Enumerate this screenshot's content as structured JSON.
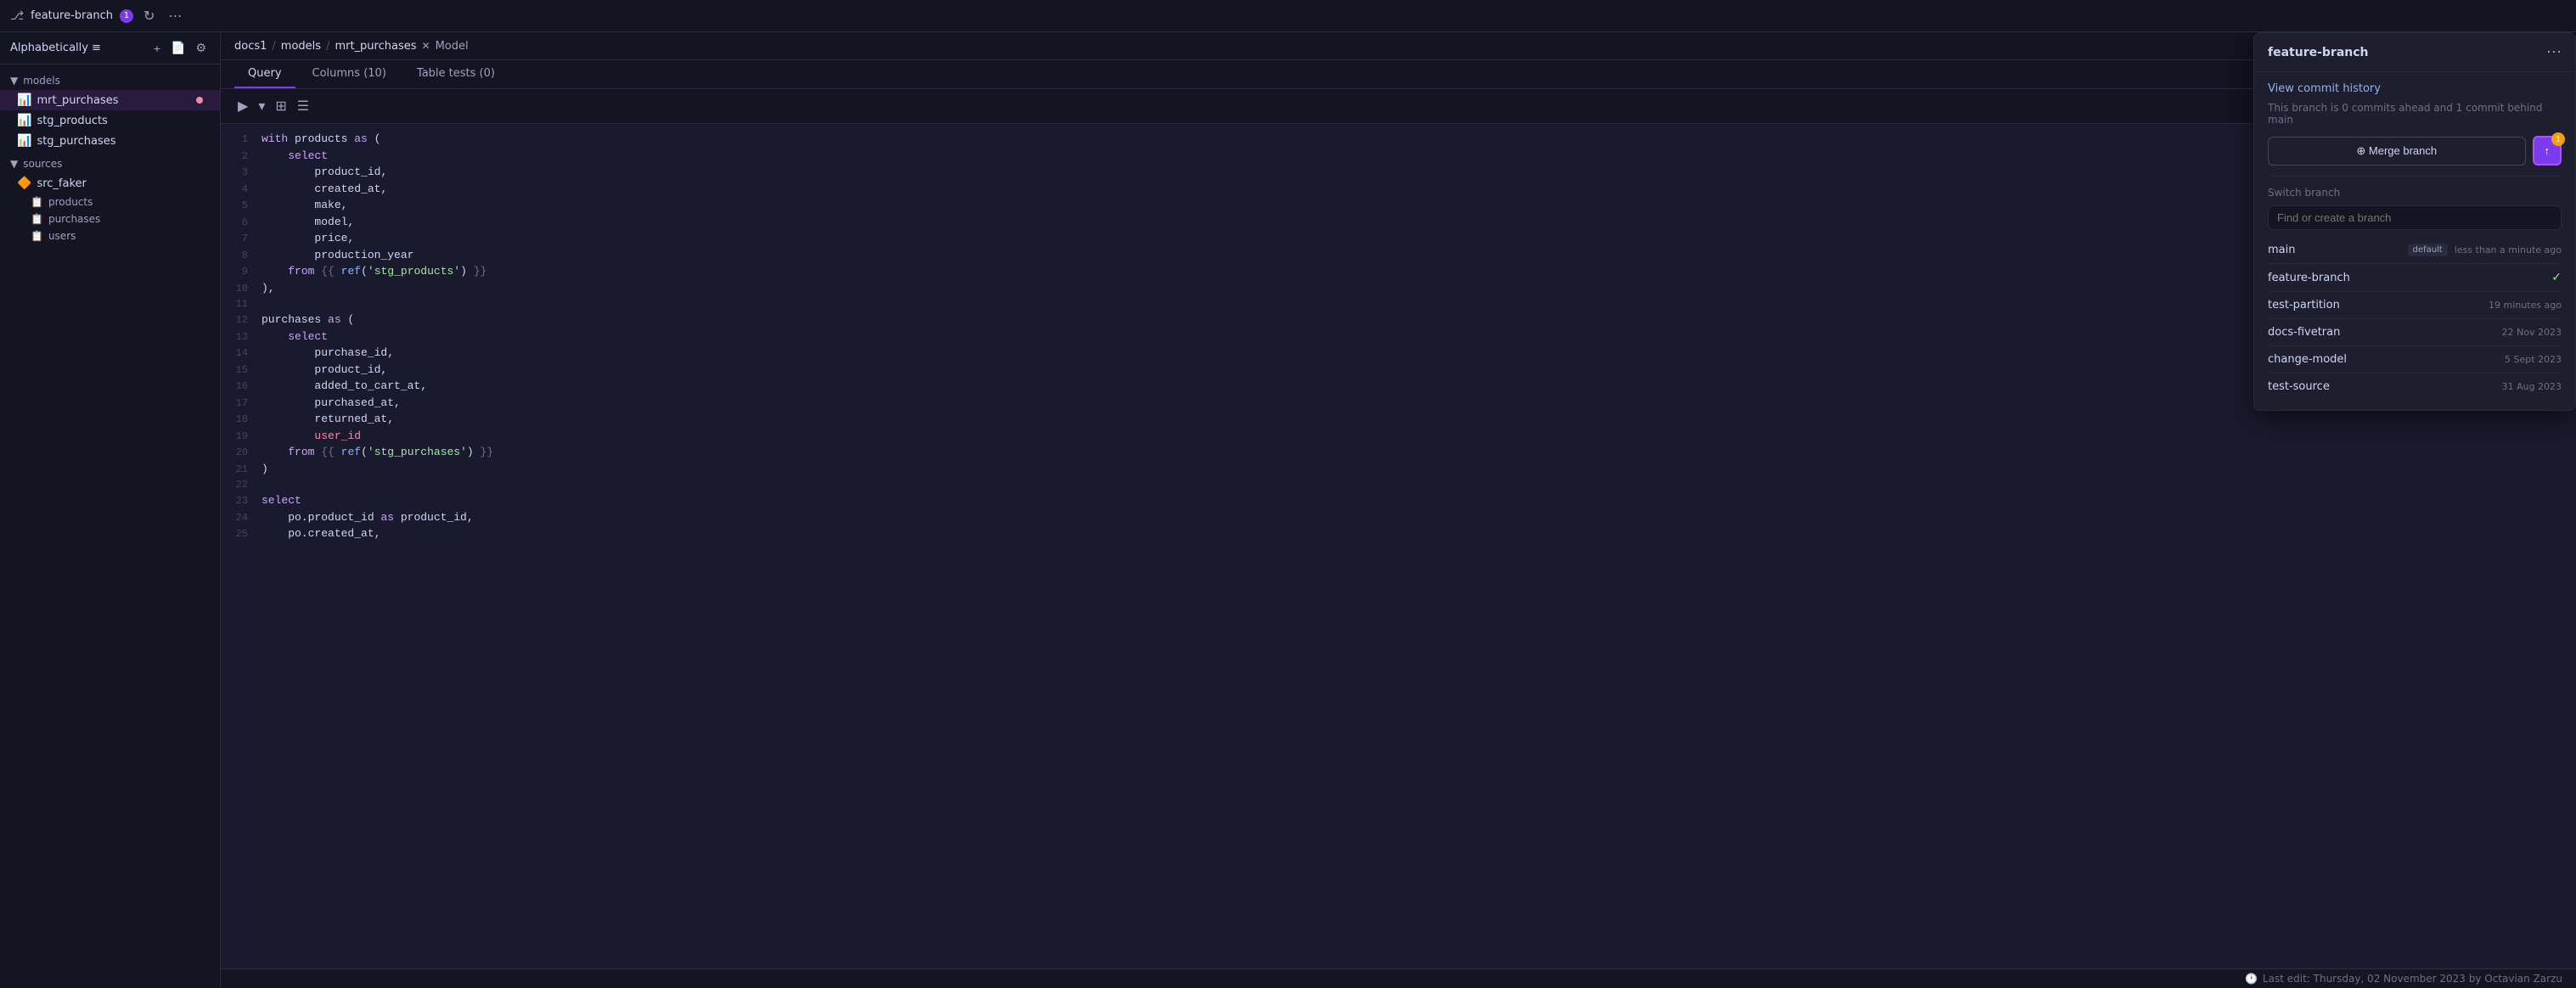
{
  "topbar": {
    "branch_name": "feature-branch",
    "branch_badge": "1",
    "refresh_icon": "↻",
    "more_icon": "⋯"
  },
  "sidebar": {
    "sort_label": "Alphabetically",
    "sort_icon": "≡",
    "add_icon": "+",
    "file_icon": "📄",
    "settings_icon": "⚙",
    "sections": {
      "models": {
        "label": "models",
        "icon": "▼",
        "items": [
          {
            "id": "mrt_purchases",
            "label": "mrt_purchases",
            "icon": "📊",
            "active": true,
            "has_dot": true
          },
          {
            "id": "stg_products",
            "label": "stg_products",
            "icon": "📊"
          },
          {
            "id": "stg_purchases",
            "label": "stg_purchases",
            "icon": "📊"
          }
        ]
      },
      "sources": {
        "label": "sources",
        "icon": "▼",
        "items": [
          {
            "id": "src_faker",
            "label": "src_faker",
            "icon": "🔶",
            "children": [
              {
                "id": "products",
                "label": "products",
                "icon": "📋"
              },
              {
                "id": "purchases",
                "label": "purchases",
                "icon": "📋"
              },
              {
                "id": "users",
                "label": "users",
                "icon": "📋"
              }
            ]
          }
        ]
      }
    }
  },
  "breadcrumb": {
    "parts": [
      "docs1",
      "models",
      "mrt_purchases"
    ],
    "separators": [
      "/",
      "/"
    ],
    "file_type": "Model",
    "file_icon": "✕"
  },
  "tabs": [
    {
      "id": "query",
      "label": "Query",
      "active": true
    },
    {
      "id": "columns",
      "label": "Columns (10)",
      "active": false
    },
    {
      "id": "table_tests",
      "label": "Table tests (0)",
      "active": false
    }
  ],
  "toolbar": {
    "run_icon": "▶",
    "dropdown_icon": "▾",
    "format_icon": "⊞",
    "list_icon": "☰"
  },
  "code_lines": [
    {
      "num": 1,
      "content": "with products as ("
    },
    {
      "num": 2,
      "content": "    select"
    },
    {
      "num": 3,
      "content": "        product_id,"
    },
    {
      "num": 4,
      "content": "        created_at,"
    },
    {
      "num": 5,
      "content": "        make,"
    },
    {
      "num": 6,
      "content": "        model,"
    },
    {
      "num": 7,
      "content": "        price,"
    },
    {
      "num": 8,
      "content": "        production_year"
    },
    {
      "num": 9,
      "content": "    from {{ ref('stg_products') }}"
    },
    {
      "num": 10,
      "content": "),"
    },
    {
      "num": 11,
      "content": ""
    },
    {
      "num": 12,
      "content": "purchases as ("
    },
    {
      "num": 13,
      "content": "    select"
    },
    {
      "num": 14,
      "content": "        purchase_id,"
    },
    {
      "num": 15,
      "content": "        product_id,"
    },
    {
      "num": 16,
      "content": "        added_to_cart_at,"
    },
    {
      "num": 17,
      "content": "        purchased_at,"
    },
    {
      "num": 18,
      "content": "        returned_at,"
    },
    {
      "num": 19,
      "content": "        user_id"
    },
    {
      "num": 20,
      "content": "    from {{ ref('stg_purchases') }}"
    },
    {
      "num": 21,
      "content": ")"
    },
    {
      "num": 22,
      "content": ""
    },
    {
      "num": 23,
      "content": "select"
    },
    {
      "num": 24,
      "content": "    po.product_id as product_id,"
    },
    {
      "num": 25,
      "content": "    po.created_at,"
    }
  ],
  "last_edit": {
    "icon": "🕐",
    "text": "Last edit: Thursday, 02 November 2023 by Octavian Zarzu"
  },
  "branch_popup": {
    "title": "feature-branch",
    "view_commit_label": "View commit history",
    "commit_info": "This branch is 0 commits ahead and 1 commit behind main",
    "merge_label": "⊕ Merge branch",
    "push_icon": "↑",
    "push_badge": "1",
    "switch_branch_label": "Switch branch",
    "search_placeholder": "Find or create a branch",
    "branches": [
      {
        "id": "main",
        "name": "main",
        "badge": "default",
        "time": "less than a minute ago",
        "current": false
      },
      {
        "id": "feature-branch",
        "name": "feature-branch",
        "badge": null,
        "time": null,
        "current": true
      },
      {
        "id": "test-partition",
        "name": "test-partition",
        "badge": null,
        "time": "19 minutes ago",
        "current": false
      },
      {
        "id": "docs-fivetran",
        "name": "docs-fivetran",
        "badge": null,
        "time": "22 Nov 2023",
        "current": false
      },
      {
        "id": "change-model",
        "name": "change-model",
        "badge": null,
        "time": "5 Sept 2023",
        "current": false
      },
      {
        "id": "test-source",
        "name": "test-source",
        "badge": null,
        "time": "31 Aug 2023",
        "current": false
      }
    ]
  }
}
